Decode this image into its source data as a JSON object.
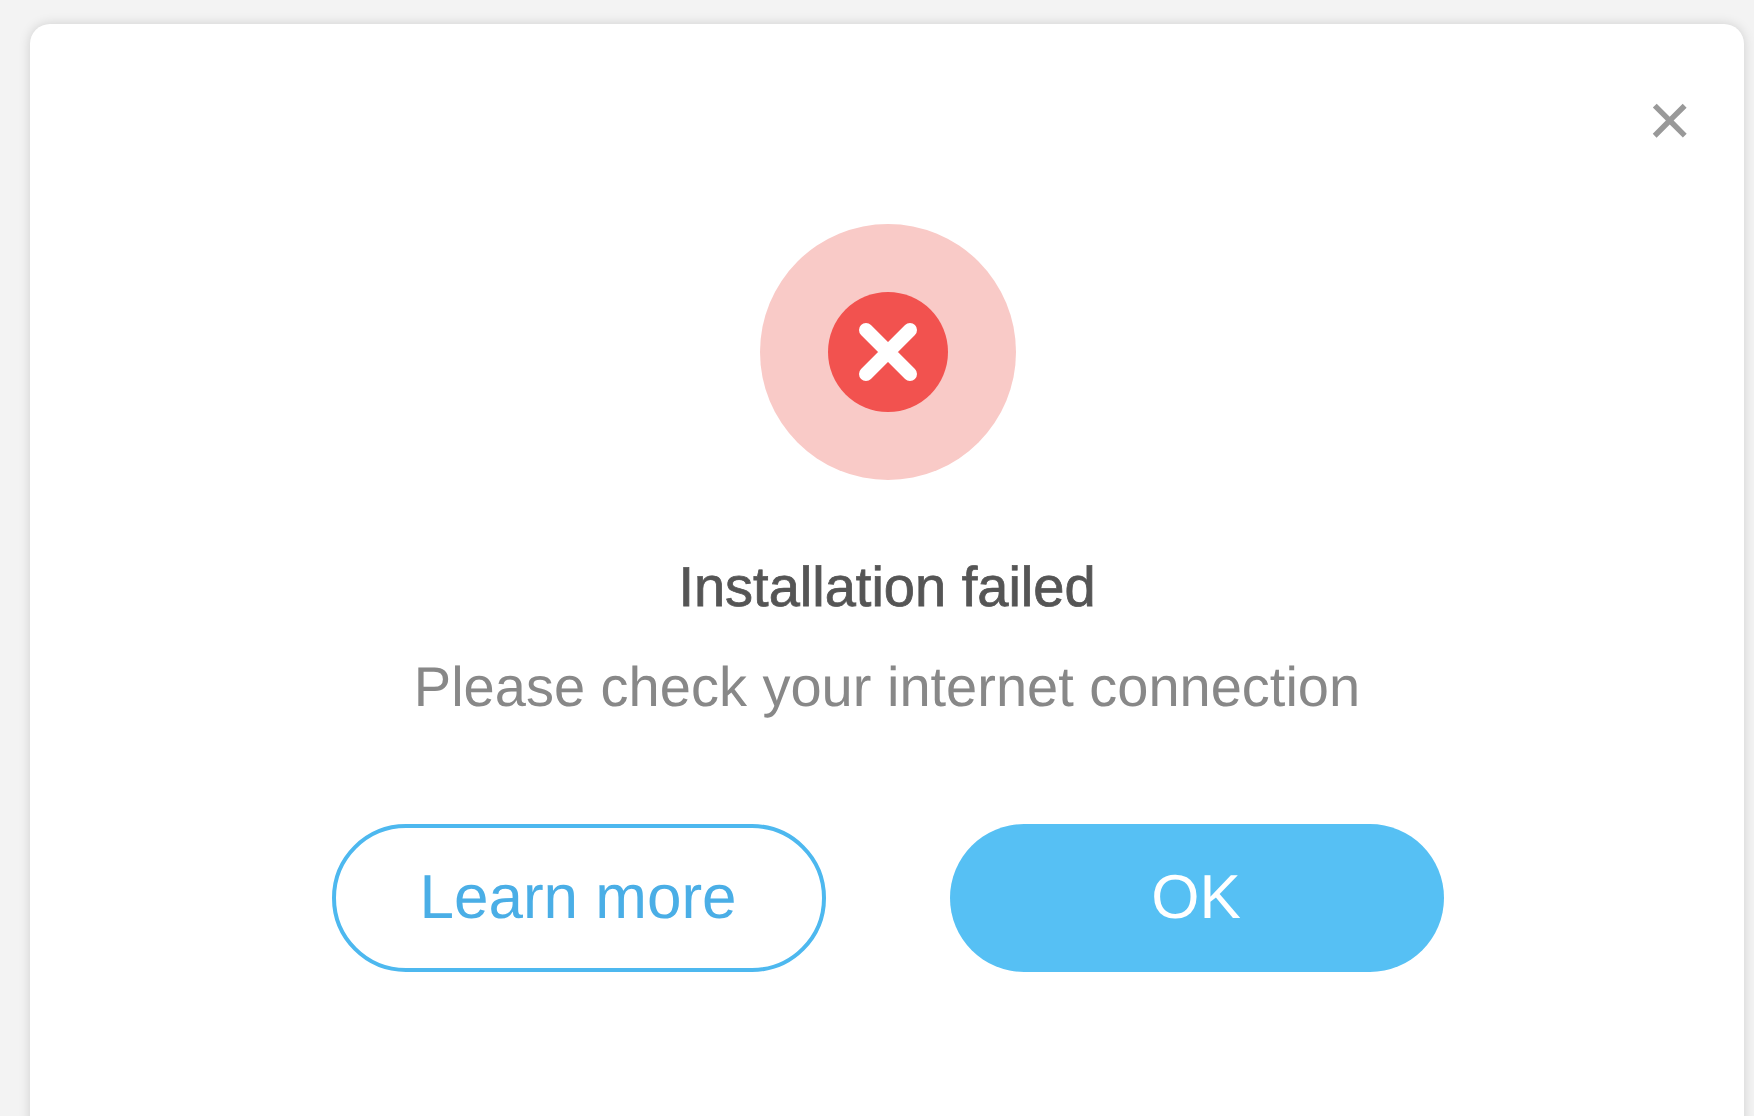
{
  "dialog": {
    "close": "×",
    "title": "Installation failed",
    "message": "Please check your internet connection",
    "buttons": [
      {
        "label": "Learn more",
        "kind": "secondary"
      },
      {
        "label": "OK",
        "kind": "primary"
      }
    ]
  }
}
